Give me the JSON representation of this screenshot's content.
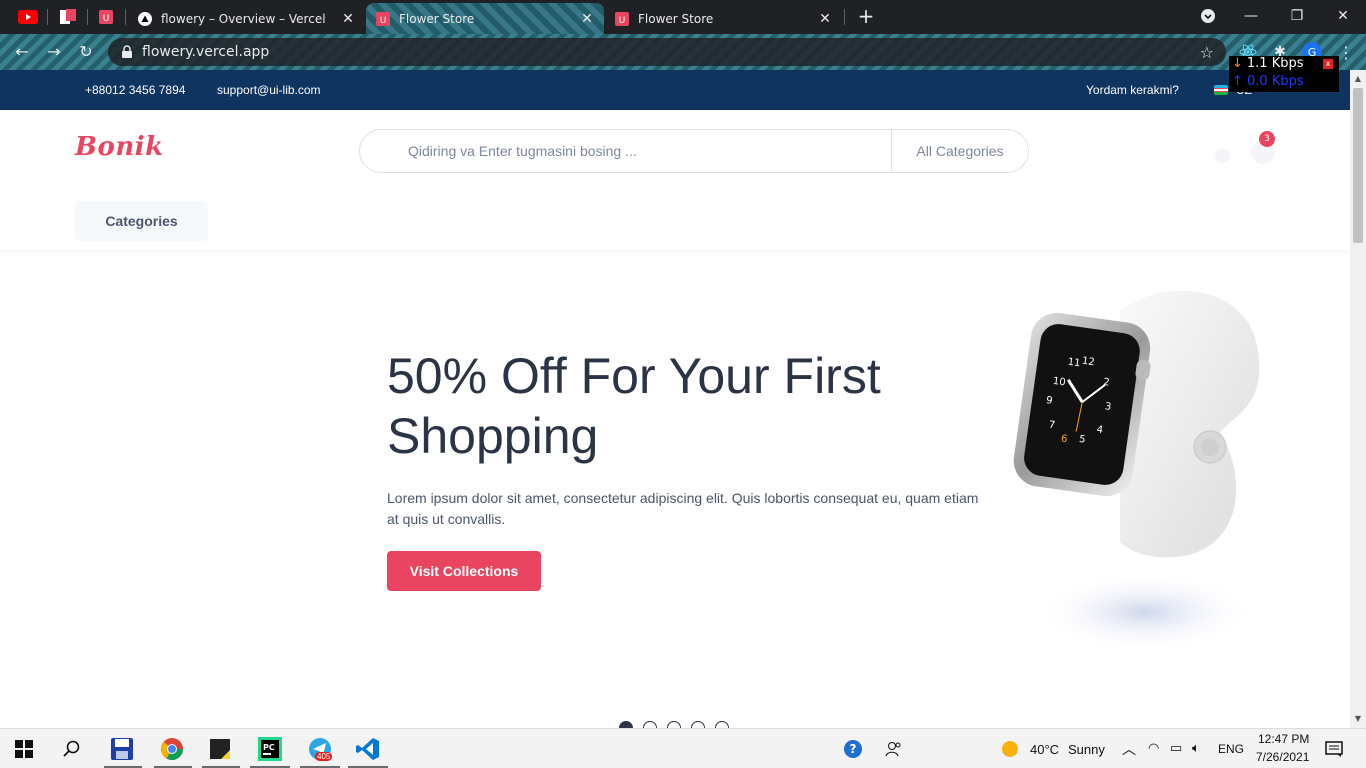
{
  "browser": {
    "tabs": [
      {
        "title": "flowery – Overview – Vercel",
        "active": false
      },
      {
        "title": "Flower Store",
        "active": true
      },
      {
        "title": "Flower Store",
        "active": false
      }
    ],
    "url": "flowery.vercel.app",
    "profile_initial": "G"
  },
  "netmeter": {
    "download": "1.1 Kbps",
    "upload": "0.0 Kbps",
    "close": "x"
  },
  "topbar": {
    "phone": "+88012 3456 7894",
    "email": "support@ui-lib.com",
    "help": "Yordam kerakmi?",
    "lang": "UZ"
  },
  "header": {
    "logo": "Bonik",
    "search_placeholder": "Qidiring va Enter tugmasini bosing ...",
    "category_select": "All Categories",
    "cart_count": "3",
    "categories_button": "Categories"
  },
  "hero": {
    "title": "50% Off For Your First Shopping",
    "description": "Lorem ipsum dolor sit amet, consectetur adipiscing elit. Quis lobortis consequat eu, quam etiam at quis ut convallis.",
    "button": "Visit Collections",
    "slide_count": 5
  },
  "taskbar": {
    "weather_temp": "40°C",
    "weather_desc": "Sunny",
    "language": "ENG",
    "time": "12:47 PM",
    "date": "7/26/2021",
    "telegram_badge": "405"
  },
  "colors": {
    "brand": "#e94560",
    "topbar": "#0f3460",
    "text": "#2b3445"
  }
}
